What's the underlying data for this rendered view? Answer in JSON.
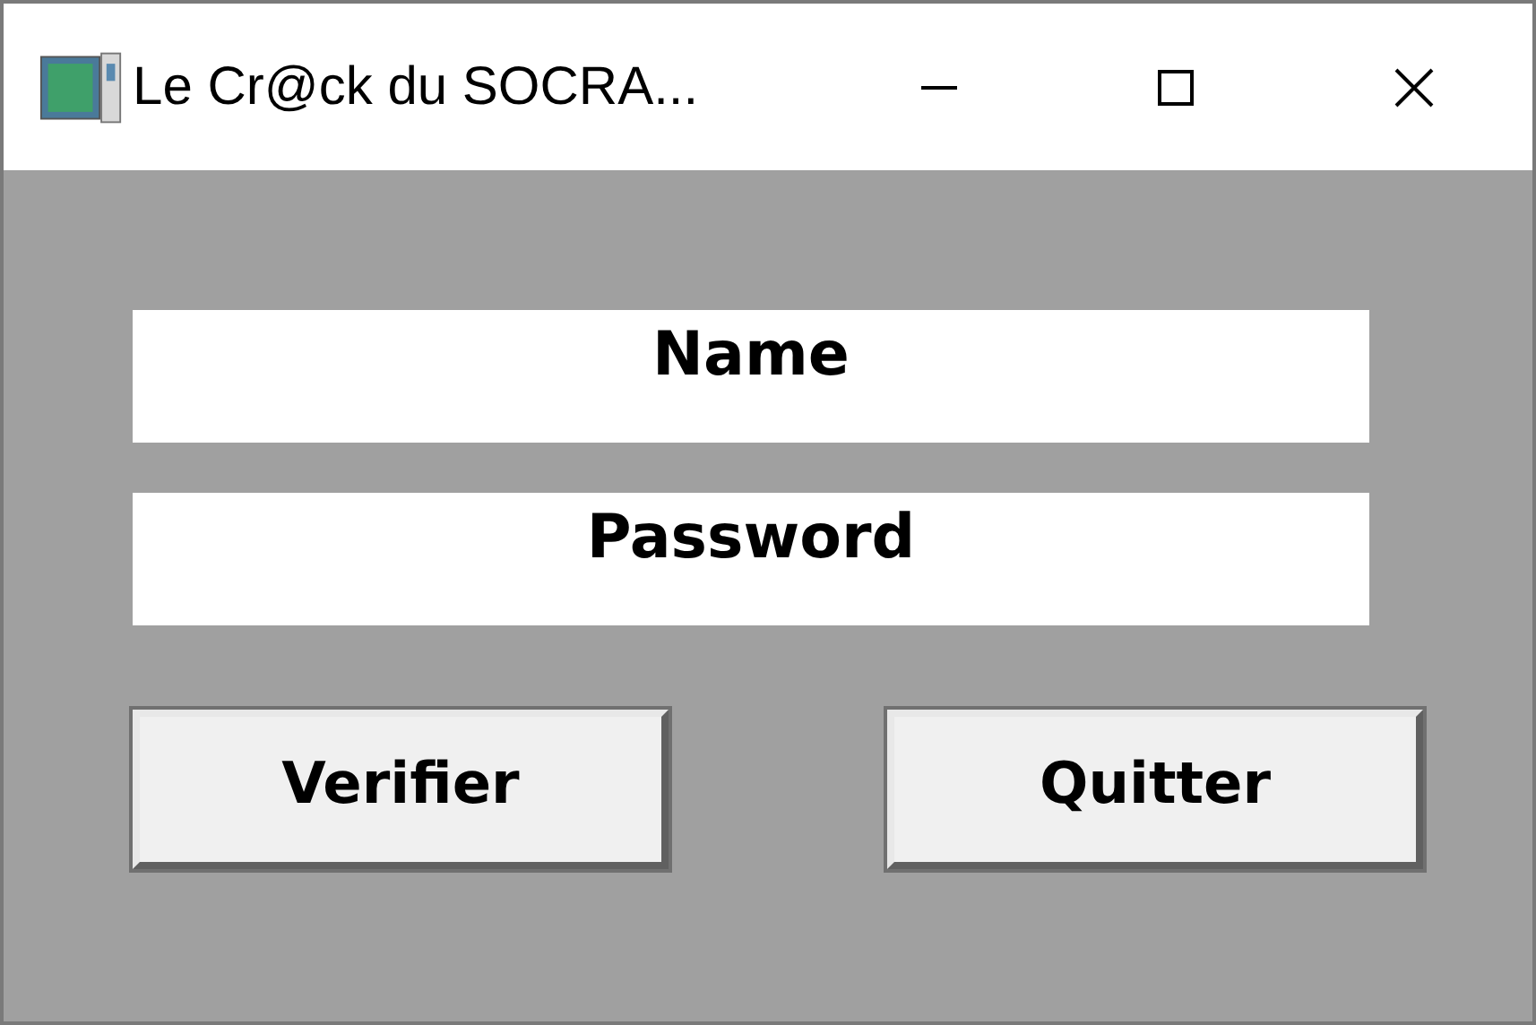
{
  "window": {
    "title": "Le Cr@ck du SOCRA..."
  },
  "fields": [
    {
      "value": "Name"
    },
    {
      "value": "Password"
    }
  ],
  "buttons": [
    "Verifier",
    "Quitter"
  ]
}
